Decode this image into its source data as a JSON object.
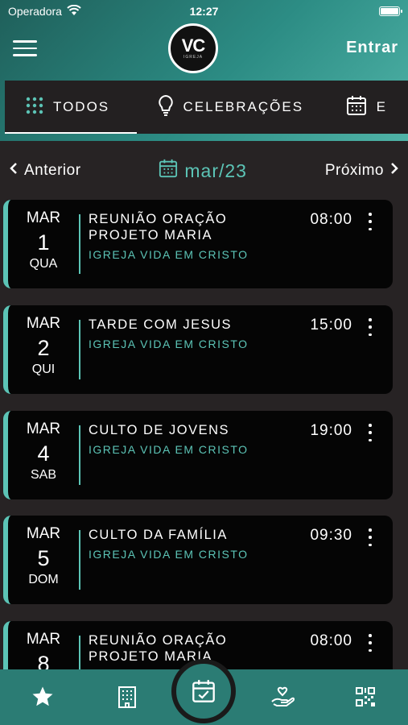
{
  "status_bar": {
    "carrier": "Operadora",
    "time": "12:27"
  },
  "header": {
    "logo_text": "VC",
    "logo_subtext": "IGREJA",
    "login_label": "Entrar"
  },
  "tabs": [
    {
      "label": "TODOS",
      "icon": "grid-icon",
      "active": true
    },
    {
      "label": "CELEBRAÇÕES",
      "icon": "lightbulb-icon",
      "active": false
    },
    {
      "label": "E",
      "icon": "calendar-icon",
      "active": false
    }
  ],
  "month_nav": {
    "prev_label": "Anterior",
    "current_month": "mar/23",
    "next_label": "Próximo"
  },
  "events": [
    {
      "month": "MAR",
      "day": "1",
      "weekday": "QUA",
      "title": "REUNIÃO ORAÇÃO PROJETO MARIA",
      "church": "IGREJA VIDA EM CRISTO",
      "time": "08:00"
    },
    {
      "month": "MAR",
      "day": "2",
      "weekday": "QUI",
      "title": "TARDE COM JESUS",
      "church": "IGREJA VIDA EM CRISTO",
      "time": "15:00"
    },
    {
      "month": "MAR",
      "day": "4",
      "weekday": "SAB",
      "title": "CULTO DE JOVENS",
      "church": "IGREJA VIDA EM CRISTO",
      "time": "19:00"
    },
    {
      "month": "MAR",
      "day": "5",
      "weekday": "DOM",
      "title": "CULTO DA FAMÍLIA",
      "church": "IGREJA VIDA EM CRISTO",
      "time": "09:30"
    },
    {
      "month": "MAR",
      "day": "8",
      "weekday": "",
      "title": "REUNIÃO ORAÇÃO PROJETO MARIA",
      "church": "",
      "time": "08:00"
    }
  ],
  "bottom_nav": [
    "star-icon",
    "building-icon",
    "calendar-check-icon",
    "heart-hand-icon",
    "qr-code-icon"
  ],
  "colors": {
    "accent": "#5cc4b6",
    "header_gradient_start": "#1f5f5a",
    "card_bg": "#050505",
    "page_bg": "#272324"
  }
}
